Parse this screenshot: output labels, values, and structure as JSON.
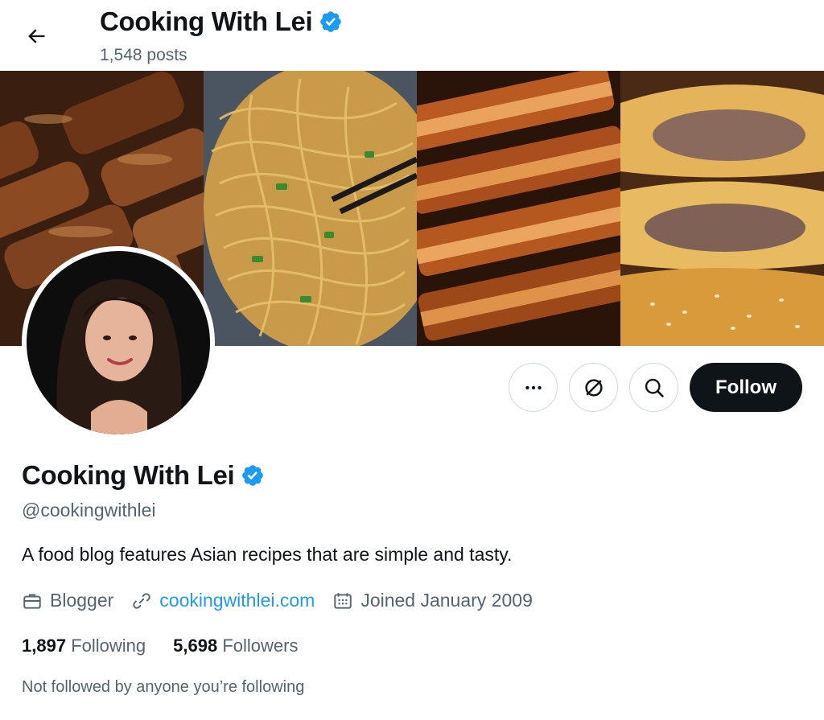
{
  "header": {
    "title": "Cooking With Lei",
    "posts_count": "1,548 posts"
  },
  "profile": {
    "name": "Cooking With Lei",
    "handle": "@cookingwithlei",
    "bio": "A food blog features Asian recipes that are simple and tasty.",
    "category": "Blogger",
    "website": "cookingwithlei.com",
    "joined": "Joined January 2009",
    "following_count": "1,897",
    "following_label": "Following",
    "followers_count": "5,698",
    "followers_label": "Followers",
    "not_followed_text": "Not followed by anyone you’re following"
  },
  "actions": {
    "follow_label": "Follow",
    "more_icon": "more-icon",
    "subscribe_icon": "subscribe-icon",
    "search_icon": "search-icon"
  },
  "colors": {
    "text": "#0f1419",
    "secondary": "#536471",
    "link": "#1d9bf0",
    "verified": "#1d9bf0",
    "follow_bg": "#0f1419",
    "border": "#cfd9de"
  }
}
